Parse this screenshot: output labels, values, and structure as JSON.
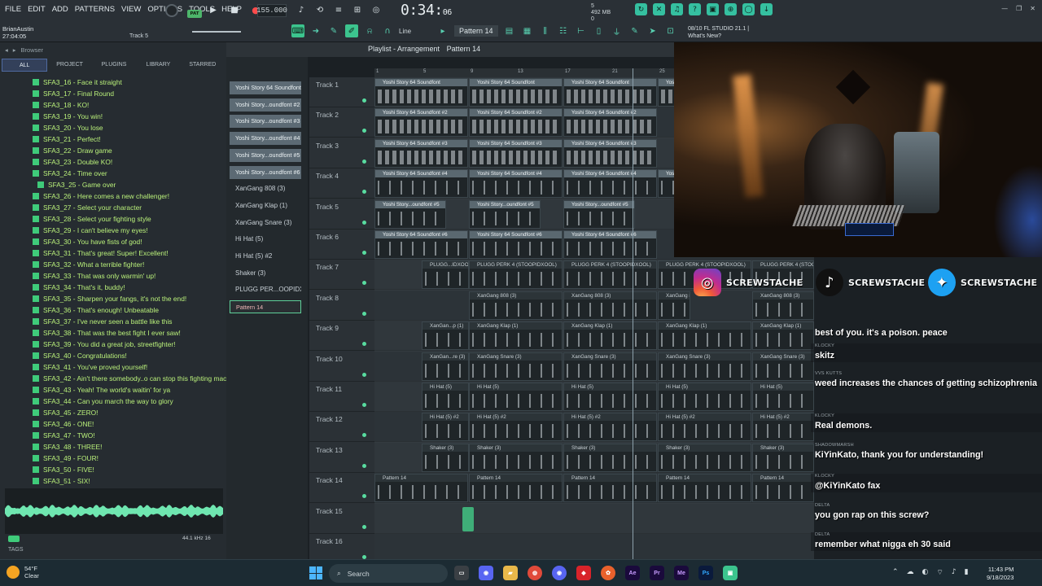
{
  "menu": [
    "FILE",
    "EDIT",
    "ADD",
    "PATTERNS",
    "VIEW",
    "OPTIONS",
    "TOOLS",
    "HELP"
  ],
  "user": {
    "name": "BrianAustin",
    "time": "27:04:05"
  },
  "hint_track": "Track 5",
  "pattern_button": "PAT",
  "tempo": "155.000",
  "song_time": {
    "main": "0:34:",
    "sub": "06"
  },
  "cpu": {
    "value": "5",
    "ram": "492 MB",
    "voices": "0"
  },
  "toolbar": {
    "snap": "Line",
    "pattern": "Pattern 14"
  },
  "fl_info": {
    "line1": "08/10  FL STUDIO 21.1 |",
    "line2": "What's New?"
  },
  "browser": {
    "title": "Browser",
    "tabs": [
      "ALL",
      "PROJECT",
      "PLUGINS",
      "LIBRARY",
      "STARRED"
    ],
    "items": [
      "SFA3_16 - Face it straight",
      "SFA3_17 - Final Round",
      "SFA3_18 - KO!",
      "SFA3_19 - You win!",
      "SFA3_20 - You lose",
      "SFA3_21 - Perfect!",
      "SFA3_22 - Draw game",
      "SFA3_23 - Double KO!",
      "SFA3_24 - Time over",
      "SFA3_25 - Game over",
      "SFA3_26 - Here comes a new challenger!",
      "SFA3_27 - Select your character",
      "SFA3_28 - Select your fighting style",
      "SFA3_29 - I can't believe my eyes!",
      "SFA3_30 - You have fists of god!",
      "SFA3_31 - That's great! Super! Excellent!",
      "SFA3_32 - What a terrible fighter!",
      "SFA3_33 - That was only warmin' up!",
      "SFA3_34 - That's it, buddy!",
      "SFA3_35 - Sharpen your fangs, it's not the end!",
      "SFA3_36 - That's enough! Unbeatable",
      "SFA3_37 - I've never seen a battle like this",
      "SFA3_38 - That was the best fight I ever saw!",
      "SFA3_39 - You did a great job, streetfighter!",
      "SFA3_40 - Congratulations!",
      "SFA3_41 - You've proved yourself!",
      "SFA3_42 - Ain't there somebody..o can stop this fighting machine",
      "SFA3_43 - Yeah! The world's waitin' for ya",
      "SFA3_44 - Can you march the way to glory",
      "SFA3_45 - ZERO!",
      "SFA3_46 - ONE!",
      "SFA3_47 - TWO!",
      "SFA3_48 - THREE!",
      "SFA3_49 - FOUR!",
      "SFA3_50 - FIVE!",
      "SFA3_51 - SIX!"
    ],
    "sample_info": "44.1 kHz 16",
    "tags_label": "TAGS"
  },
  "playlist": {
    "title": "Playlist - Arrangement",
    "pattern": "Pattern 14",
    "ruler": [
      "1",
      "5",
      "9",
      "13",
      "17",
      "21",
      "25"
    ]
  },
  "channels": [
    "Yoshi Story 64 Soundfont",
    "Yoshi Story...oundfont #2",
    "Yoshi Story...oundfont #3",
    "Yoshi Story...oundfont #4",
    "Yoshi Story...oundfont #5",
    "Yoshi Story...oundfont #6",
    "XanGang 808  (3)",
    "XanGang Klap  (1)",
    "XanGang Snare  (3)",
    "Hi Hat  (5)",
    "Hi Hat  (5) #2",
    "Shaker  (3)",
    "PLUGG PER...OOPIDXOOL)",
    "Pattern 14"
  ],
  "tracks": [
    "Track 1",
    "Track 2",
    "Track 3",
    "Track 4",
    "Track 5",
    "Track 6",
    "Track 7",
    "Track 8",
    "Track 9",
    "Track 10",
    "Track 11",
    "Track 12",
    "Track 13",
    "Track 14",
    "Track 15",
    "Track 16"
  ],
  "clips": {
    "t1": [
      "Yoshi Story 64 Soundfont",
      "Yoshi Story 64 Soundfont",
      "Yoshi Story 64 Soundfont",
      "Yoshi Story 64 Soundfont"
    ],
    "t2": [
      "Yoshi Story 64 Soundfont #2",
      "Yoshi Story 64 Soundfont #2",
      "Yoshi Story 64 Soundfont #2"
    ],
    "t3": [
      "Yoshi Story 64 Soundfont #3",
      "Yoshi Story 64 Soundfont #3",
      "Yoshi Story 64 Soundfont #3"
    ],
    "t4": [
      "Yoshi Story 64 Soundfont #4",
      "Yoshi Story 64 Soundfont #4",
      "Yoshi Story 64 Soundfont #4",
      "Yosl"
    ],
    "t5": [
      "Yoshi Story...oundfont #5",
      "Yoshi Story...oundfont #5",
      "Yoshi Story...oundfont #5"
    ],
    "t6": [
      "Yoshi Story 64 Soundfont #6",
      "Yoshi Story 64 Soundfont #6",
      "Yoshi Story 64 Soundfont #6"
    ],
    "t7": [
      "PLUGG...IDXOOL)",
      "PLUGG PERK 4 (STOOPIDXOOL)",
      "PLUGG PERK 4 (STOOPIDXOOL)",
      "PLUGG PERK 4 (STOOPIDXOOL)",
      "PLUGG PERK 4 (STOOPIDXOOL)"
    ],
    "t8": [
      "XanGang 808  (3)",
      "XanGang 808  (3)",
      "XanGang 8",
      "XanGang 808  (3)"
    ],
    "t9": [
      "XanGan...p  (1)",
      "XanGang Klap  (1)",
      "XanGang Klap  (1)",
      "XanGang Klap  (1)",
      "XanGang Klap  (1)"
    ],
    "t10": [
      "XanGan...re  (3)",
      "XanGang Snare  (3)",
      "XanGang Snare  (3)",
      "XanGang Snare  (3)",
      "XanGang Snare  (3)"
    ],
    "t11": [
      "Hi Hat  (5)",
      "Hi Hat  (5)",
      "Hi Hat  (5)",
      "Hi Hat  (5)",
      "Hi Hat  (5)"
    ],
    "t12": [
      "Hi Hat  (5) #2",
      "Hi Hat  (5) #2",
      "Hi Hat  (5) #2",
      "Hi Hat  (5) #2",
      "Hi Hat  (5) #2"
    ],
    "t13": [
      "Shaker  (3)",
      "Shaker  (3)",
      "Shaker  (3)",
      "Shaker  (3)",
      "Shaker  (3)"
    ],
    "t14": [
      "Pattern 14",
      "Pattern 14",
      "Pattern 14",
      "Pattern 14",
      "Pattern 14"
    ]
  },
  "socials": [
    {
      "icon": "instagram-icon",
      "handle": "SCREWSTACHE"
    },
    {
      "icon": "tiktok-icon",
      "handle": "SCREWSTACHE"
    },
    {
      "icon": "twitter-icon",
      "handle": "SCREWSTACHE"
    }
  ],
  "chat": [
    {
      "author": "",
      "text": "best of you. it's a poison. peace"
    },
    {
      "author": "KLOCKY",
      "text": "skitz"
    },
    {
      "author": "VVS KUTTS",
      "text": "weed increases the chances of getting schizophrenia"
    },
    {
      "author": "KLOCKY",
      "text": "Real demons."
    },
    {
      "author": "SHADOWMARSH",
      "text": "KiYinKato, thank you for understanding!"
    },
    {
      "author": "KLOCKY",
      "text": "@KiYinKato fax"
    },
    {
      "author": "DELTA",
      "text": "you gon rap on this screw?"
    },
    {
      "author": "DELTA",
      "text": "remember what nigga eh 30 said"
    }
  ],
  "taskbar": {
    "weather_temp": "54°F",
    "weather_desc": "Clear",
    "search_placeholder": "Search",
    "time": "11:43 PM",
    "date": "9/18/2023",
    "apps": [
      "Ae",
      "Pr",
      "Me",
      "Ps"
    ]
  }
}
